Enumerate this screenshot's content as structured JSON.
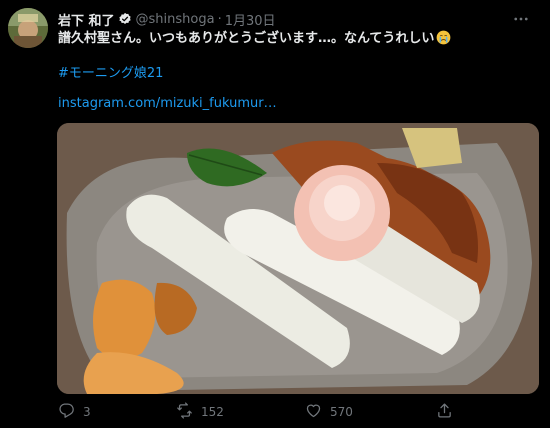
{
  "tweet": {
    "display_name": "岩下 和了",
    "handle": "@shinshoga",
    "separator": "·",
    "date": "1月30日",
    "text": "譜久村聖さん。いつもありがとうございます…。なんてうれしい",
    "emoji": "crying-face-emoji",
    "hashtag": "#モーニング娘21",
    "link": "instagram.com/mizuki_fukumur…"
  },
  "actions": {
    "replies": "3",
    "retweets": "152",
    "likes": "570"
  },
  "icons": {
    "more": "more-horizontal-icon",
    "verified": "verified-badge-icon",
    "reply": "reply-icon",
    "retweet": "retweet-icon",
    "like": "heart-icon",
    "share": "share-icon"
  },
  "colors": {
    "background": "#000000",
    "text": "#e7e9ea",
    "secondary": "#71767b",
    "link": "#1d9bf0"
  }
}
